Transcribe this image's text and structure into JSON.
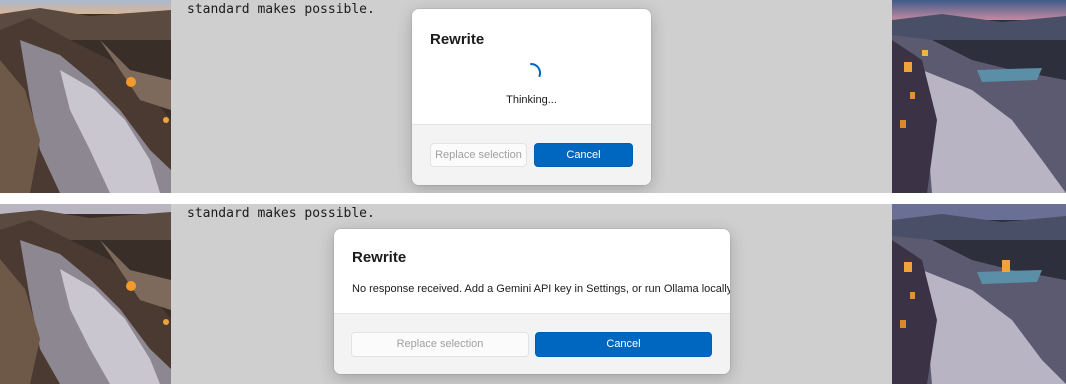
{
  "editor": {
    "text": "standard makes possible."
  },
  "dialog_thinking": {
    "title": "Rewrite",
    "status": "Thinking...",
    "replace_label": "Replace selection",
    "cancel_label": "Cancel"
  },
  "dialog_error": {
    "title": "Rewrite",
    "message": "No response received. Add a Gemini API key in Settings, or run Ollama locally.",
    "replace_label": "Replace selection",
    "cancel_label": "Cancel"
  },
  "colors": {
    "accent": "#0067c0",
    "editor_background": "#cfcfcf",
    "footer_background": "#f3f3f3"
  }
}
